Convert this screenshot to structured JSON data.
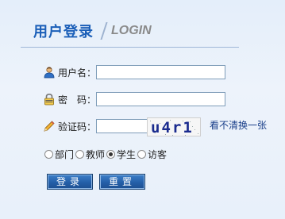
{
  "header": {
    "title_cn": "用户登录",
    "title_en": "LOGIN"
  },
  "form": {
    "username_label": "用户名：",
    "password_label": "密　码：",
    "captcha_label": "验证码：",
    "username_value": "",
    "password_value": "",
    "captcha_value": "",
    "captcha_text": "u4r1",
    "refresh_link": "看不清换一张"
  },
  "roles": [
    {
      "label": "部门",
      "checked": false
    },
    {
      "label": "教师",
      "checked": false
    },
    {
      "label": "学生",
      "checked": true
    },
    {
      "label": "访客",
      "checked": false
    }
  ],
  "buttons": {
    "login": "登录",
    "reset": "重置"
  },
  "colors": {
    "title": "#1b5fb8",
    "button": "#245fa8",
    "background": "#e8f0fa"
  },
  "icons": {
    "username": "user-icon",
    "password": "lock-icon",
    "captcha": "pencil-icon"
  }
}
